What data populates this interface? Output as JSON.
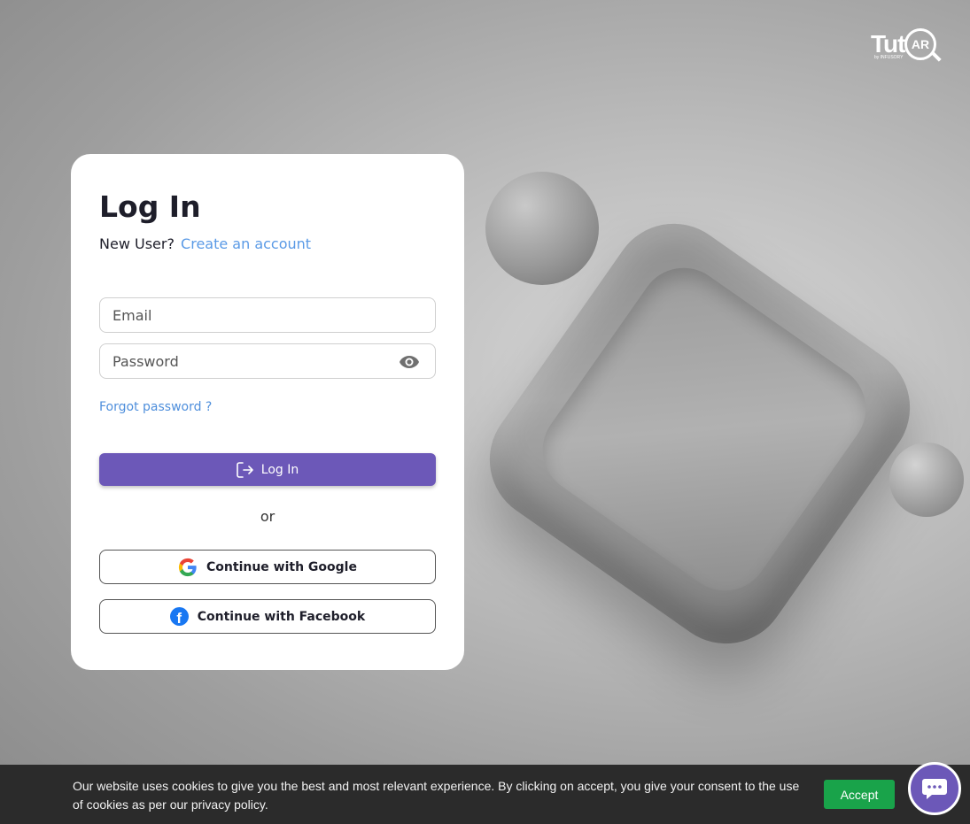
{
  "brand": {
    "logo_text": "Tut",
    "logo_ring_text": "AR",
    "logo_sub": "by INFUSORY"
  },
  "login": {
    "title": "Log In",
    "new_user_label": "New User?",
    "create_account_link": "Create an account",
    "email_placeholder": "Email",
    "email_value": "",
    "password_placeholder": "Password",
    "password_value": "",
    "forgot_password_link": "Forgot password ?",
    "login_button_label": "Log In",
    "or_divider": "or",
    "google_button_label": "Continue with Google",
    "facebook_button_label": "Continue with Facebook"
  },
  "cookie_banner": {
    "text": "Our website uses cookies to give you the best and most relevant experience. By clicking on accept, you give your consent to the use of cookies as per our privacy policy.",
    "accept_label": "Accept"
  },
  "colors": {
    "primary": "#6c58b8",
    "link": "#5a9ae6",
    "accept": "#19a34a",
    "facebook": "#1877f2"
  },
  "icons": {
    "password_toggle": "eye-icon",
    "login": "logout-arrow-icon",
    "google": "google-g-icon",
    "facebook": "facebook-f-icon",
    "chat": "chat-bubble-icon"
  }
}
